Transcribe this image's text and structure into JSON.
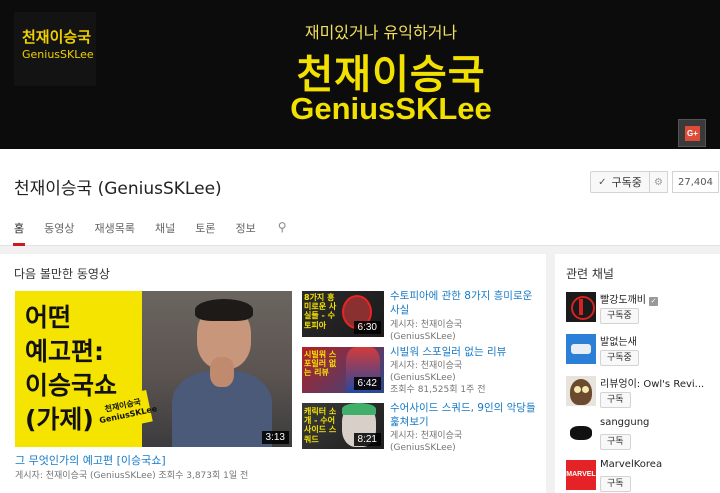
{
  "banner": {
    "logo_title": "천재이승국",
    "logo_sub": "GeniusSKLee",
    "tagline": "재미있거나 유익하거나",
    "big_title": "천재이승국",
    "big_english": "GeniusSKLee",
    "social_icon": "google-plus-icon",
    "social_label": "G+"
  },
  "header": {
    "channel_name": "천재이승국 (GeniusSKLee)",
    "subscribe_label": "구독중",
    "subscriber_count": "27,404",
    "tabs": [
      {
        "label": "홈",
        "active": true
      },
      {
        "label": "동영상"
      },
      {
        "label": "재생목록"
      },
      {
        "label": "채널"
      },
      {
        "label": "토론"
      },
      {
        "label": "정보"
      }
    ],
    "search_icon": "⚲"
  },
  "main": {
    "section_title": "다음 볼만한 동영상",
    "featured": {
      "thumb_lines": [
        "어떤",
        "예고편:",
        "이승국쇼",
        "(가제)"
      ],
      "thumb_badge": "천재이승국 GeniusSKLee",
      "duration": "3:13",
      "title": "그 무엇인가의 예고편 [이승국쇼]",
      "meta": "게시자: 천재이승국 (GeniusSKLee)  조회수 3,873회  1일 전"
    },
    "videos": [
      {
        "thumb_text": "8가지 흥미로운 사실들 - 수토피아",
        "duration": "6:30",
        "title": "수토피아에 관한 8가지 흥미로운 사실",
        "meta_lines": [
          "게시자: 천재이승국",
          "(GeniusSKLee)"
        ]
      },
      {
        "thumb_text": "시빌워 스포일러 없는 리뷰",
        "duration": "6:42",
        "title": "시빌워 스포일러 없는 리뷰",
        "meta_lines": [
          "게시자: 천재이승국",
          "(GeniusSKLee)",
          "조회수 81,525회 1주 전"
        ]
      },
      {
        "thumb_text": "캐릭터 소개 - 수어사이드 스쿼드",
        "duration": "8:21",
        "title": "수어사이드 스쿼드, 9인의 악당들 훑쳐보기",
        "meta_lines": [
          "게시자: 천재이승국",
          "(GeniusSKLee)"
        ]
      }
    ]
  },
  "related": {
    "title": "관련 채널",
    "channels": [
      {
        "name": "빨강도깨비",
        "button": "구독중",
        "verified": true
      },
      {
        "name": "발없는새",
        "button": "구독중"
      },
      {
        "name": "리뷰엉이: Owl's Revi...",
        "button": "구독"
      },
      {
        "name": "sanggung",
        "button": "구독"
      },
      {
        "name": "MarvelKorea",
        "button": "구독",
        "avatar_text": "MARVEL"
      }
    ]
  },
  "colors": {
    "banner_bg": "#0c0c0c",
    "banner_yellow": "#f2e000",
    "link_blue": "#167ac6",
    "accent_red": "#cc181e"
  }
}
